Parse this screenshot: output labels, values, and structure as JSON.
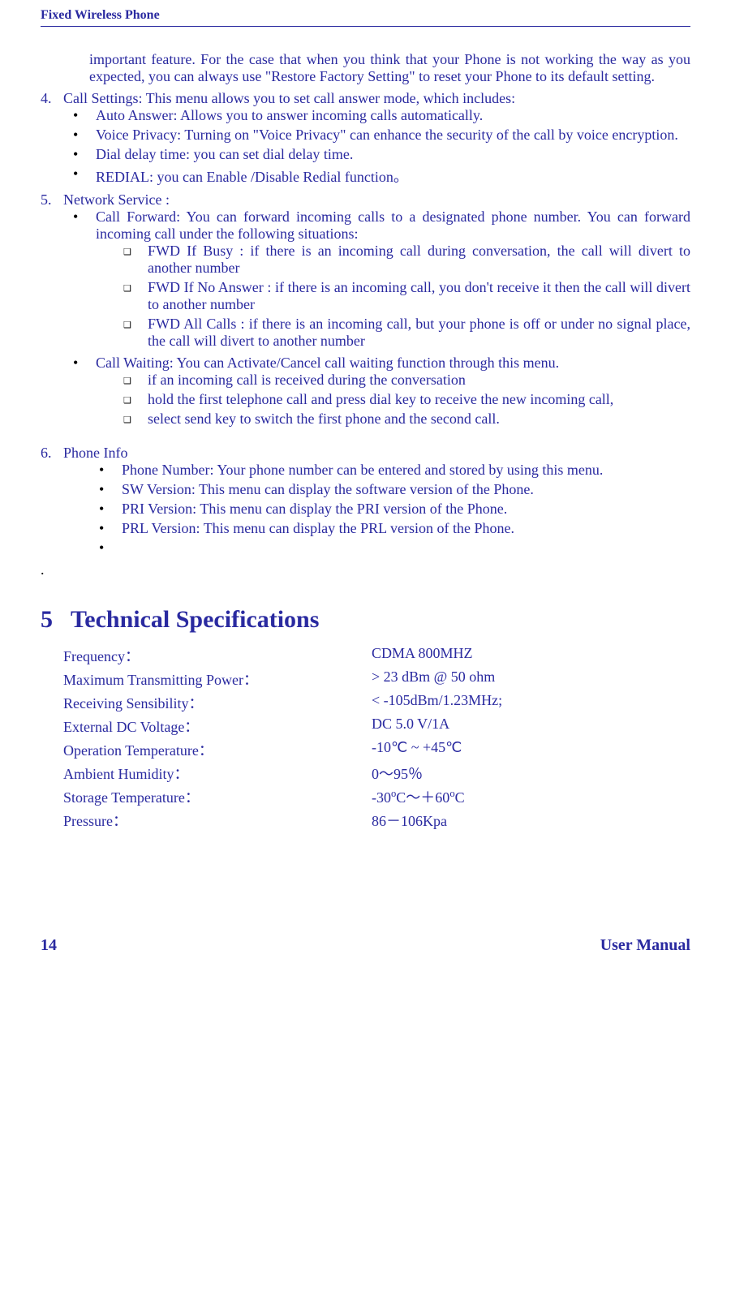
{
  "header": {
    "title": "Fixed Wireless Phone"
  },
  "continuation": "important feature. For the case that when you think that your Phone is not working the way as you expected, you can always use \"Restore Factory Setting\" to reset your Phone to its default setting.",
  "item4": {
    "num": "4.",
    "text": "Call Settings: This menu allows you to set call answer mode, which includes:",
    "bullets": [
      "Auto Answer: Allows you to answer incoming calls automatically.",
      "Voice Privacy: Turning on \"Voice Privacy\"  can enhance the security of the call by voice encryption.",
      "Dial delay time: you can set dial delay time.",
      "REDIAL: you can Enable /Disable Redial function。"
    ]
  },
  "item5": {
    "num": "5.",
    "text": "Network Service :",
    "bullet1": {
      "text": "Call Forward: You can forward incoming calls to a designated phone number. You can forward incoming call under the following situations:",
      "subs": [
        "FWD If Busy : if there is an incoming call during conversation, the call will divert to another number",
        "FWD If No Answer : if there is an incoming call, you don't receive it then the call will divert to another number",
        "FWD All Calls : if there is an incoming call, but your phone is off or under no signal place, the call will divert to another number"
      ]
    },
    "bullet2": {
      "text": "Call Waiting: You can Activate/Cancel call waiting function through this menu.",
      "subs": [
        "if an incoming call is received during the conversation",
        "hold the first telephone call and press dial key to receive the new incoming call,",
        "select send key to switch the first phone and the second call."
      ]
    }
  },
  "item6": {
    "num": "6.",
    "text": "Phone Info",
    "bullets": [
      "Phone Number: Your phone number can be entered and stored by using this menu.",
      "SW Version: This menu can display the software version of the Phone.",
      "PRI Version: This menu can display the PRI version of the Phone.",
      "PRL Version: This menu can display the PRL version of the Phone."
    ]
  },
  "trailing_dot": ".",
  "section5": {
    "num": "5",
    "title": "Technical Specifications"
  },
  "specs": [
    {
      "label": "Frequency：",
      "value": "CDMA 800MHZ"
    },
    {
      "label": "Maximum Transmitting Power：",
      "value": "> 23 dBm @ 50 ohm"
    },
    {
      "label": "Receiving Sensibility：",
      "value": "< -105dBm/1.23MHz;"
    },
    {
      "label": "External DC Voltage：",
      "value": "DC  5.0 V/1A"
    },
    {
      "label": "Operation Temperature：",
      "value": "-10℃ ~ +45℃"
    },
    {
      "label": "Ambient Humidity：",
      "value": "0～95％"
    },
    {
      "label": "Storage Temperature：",
      "value_html": "-30<sup>o</sup>C～＋60<sup>o</sup>C"
    },
    {
      "label": "Pressure：",
      "value": "86－106Kpa"
    }
  ],
  "footer": {
    "page": "14",
    "label": "User Manual"
  }
}
